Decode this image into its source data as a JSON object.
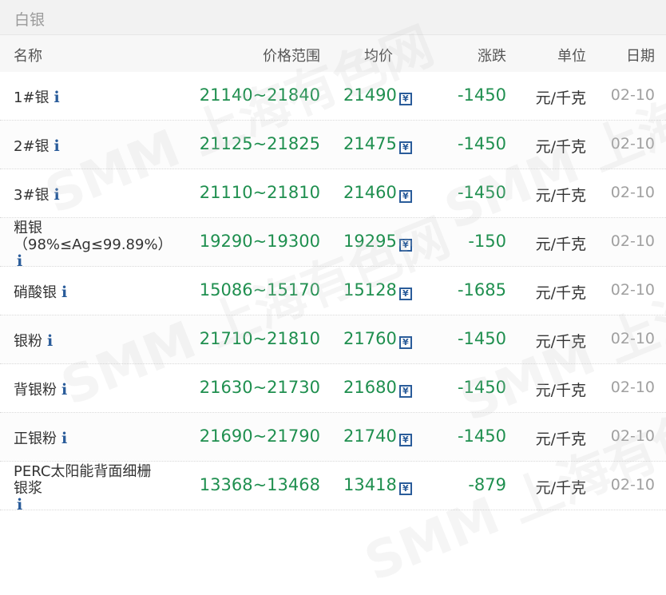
{
  "header": {
    "title": "白银"
  },
  "columns": {
    "name": "名称",
    "price_range": "价格范围",
    "avg": "均价",
    "change": "涨跌",
    "unit": "单位",
    "date": "日期"
  },
  "watermark": "SMM 上海有色网",
  "rows": [
    {
      "name_lines": [
        "1#银"
      ],
      "range": "21140~21840",
      "avg": "21490",
      "change": "-1450",
      "unit": "元/千克",
      "date": "02-10"
    },
    {
      "name_lines": [
        "2#银"
      ],
      "range": "21125~21825",
      "avg": "21475",
      "change": "-1450",
      "unit": "元/千克",
      "date": "02-10"
    },
    {
      "name_lines": [
        "3#银"
      ],
      "range": "21110~21810",
      "avg": "21460",
      "change": "-1450",
      "unit": "元/千克",
      "date": "02-10"
    },
    {
      "name_lines": [
        "粗银",
        "（98%≤Ag≤99.89%）"
      ],
      "range": "19290~19300",
      "avg": "19295",
      "change": "-150",
      "unit": "元/千克",
      "date": "02-10"
    },
    {
      "name_lines": [
        "硝酸银"
      ],
      "range": "15086~15170",
      "avg": "15128",
      "change": "-1685",
      "unit": "元/千克",
      "date": "02-10"
    },
    {
      "name_lines": [
        "银粉"
      ],
      "range": "21710~21810",
      "avg": "21760",
      "change": "-1450",
      "unit": "元/千克",
      "date": "02-10"
    },
    {
      "name_lines": [
        "背银粉"
      ],
      "range": "21630~21730",
      "avg": "21680",
      "change": "-1450",
      "unit": "元/千克",
      "date": "02-10"
    },
    {
      "name_lines": [
        "正银粉"
      ],
      "range": "21690~21790",
      "avg": "21740",
      "change": "-1450",
      "unit": "元/千克",
      "date": "02-10"
    },
    {
      "name_lines": [
        "PERC太阳能背面细栅",
        "银浆"
      ],
      "range": "13368~13468",
      "avg": "13418",
      "change": "-879",
      "unit": "元/千克",
      "date": "02-10"
    }
  ]
}
